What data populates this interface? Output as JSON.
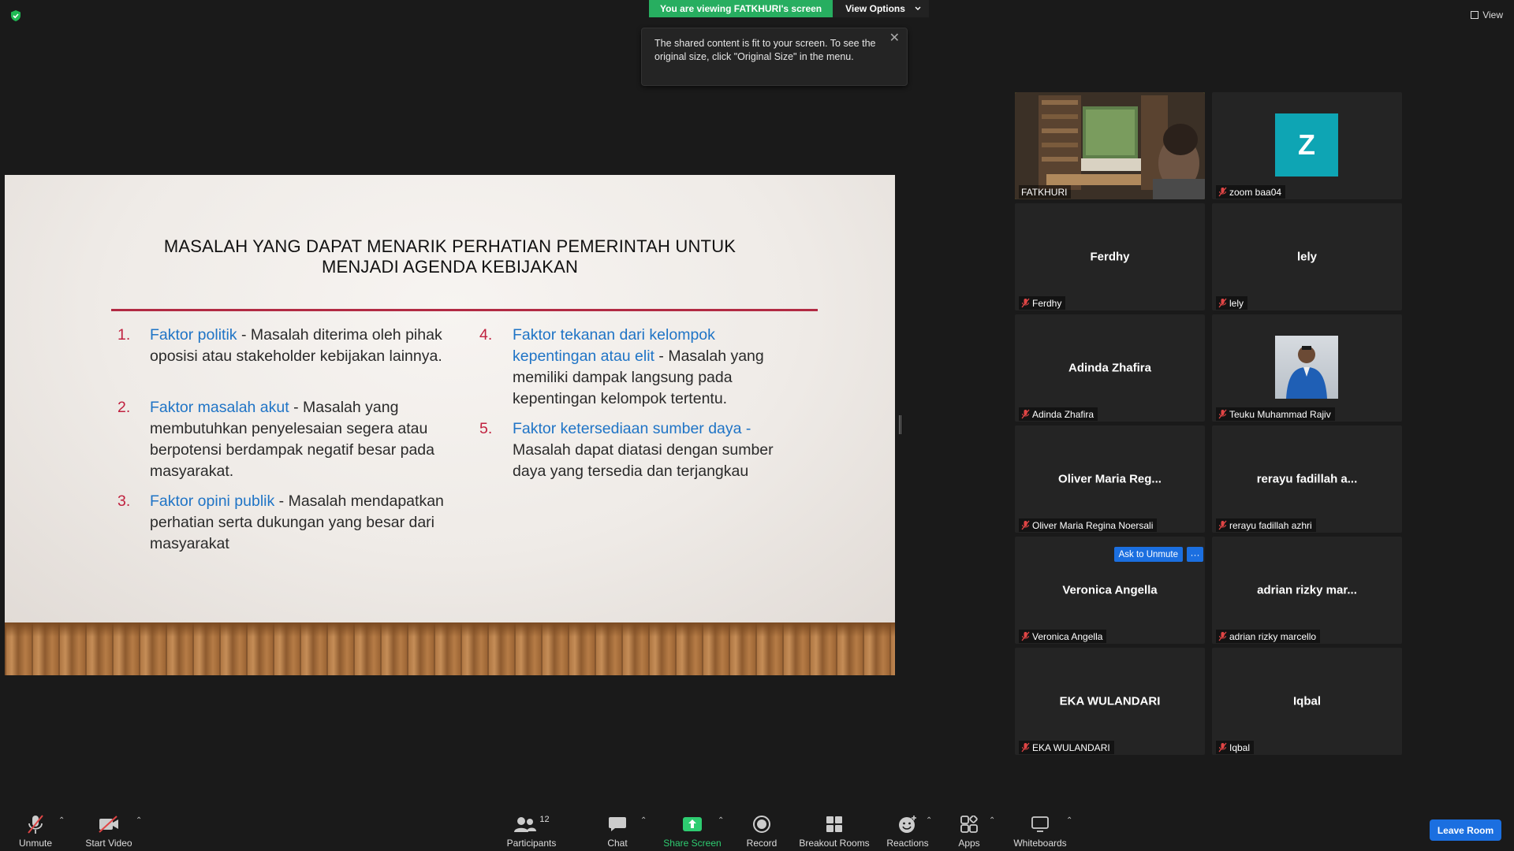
{
  "banner": {
    "viewing": "You are viewing FATKHURI's screen",
    "view_options": "View Options"
  },
  "top_right": {
    "view": "View"
  },
  "tooltip": {
    "text": "The shared content is fit to your screen. To see the original size, click \"Original Size\" in the menu."
  },
  "slide": {
    "title": "MASALAH YANG DAPAT MENARIK PERHATIAN PEMERINTAH UNTUK MENJADI AGENDA KEBIJAKAN",
    "items": [
      {
        "num": "1.",
        "head": "Faktor politik",
        "body": "Masalah diterima oleh pihak oposisi atau stakeholder kebijakan lainnya."
      },
      {
        "num": "2.",
        "head": "Faktor masalah akut",
        "body": "Masalah yang membutuhkan penyelesaian segera atau berpotensi berdampak negatif besar pada masyarakat."
      },
      {
        "num": "3.",
        "head": "Faktor opini publik",
        "body": "Masalah mendapatkan perhatian serta dukungan yang besar dari masyarakat"
      },
      {
        "num": "4.",
        "head": "Faktor tekanan dari kelompok kepentingan atau elit",
        "body": "Masalah yang memiliki dampak langsung pada kepentingan kelompok tertentu."
      },
      {
        "num": "5.",
        "head": "Faktor ketersediaan sumber daya -",
        "body": "Masalah dapat diatasi dengan sumber daya yang tersedia dan terjangkau"
      }
    ]
  },
  "participants": [
    {
      "display": "",
      "tag": "FATKHURI"
    },
    {
      "display": "Z",
      "tag": "zoom baa04"
    },
    {
      "display": "Ferdhy",
      "tag": "Ferdhy"
    },
    {
      "display": "lely",
      "tag": "lely"
    },
    {
      "display": "Adinda Zhafira",
      "tag": "Adinda Zhafira"
    },
    {
      "display": "",
      "tag": "Teuku Muhammad Rajiv"
    },
    {
      "display": "Oliver Maria Reg...",
      "tag": "Oliver Maria Regina Noersali"
    },
    {
      "display": "rerayu fadillah a...",
      "tag": "rerayu fadillah azhri"
    },
    {
      "display": "Veronica Angella",
      "tag": "Veronica Angella"
    },
    {
      "display": "adrian rizky mar...",
      "tag": "adrian rizky marcello"
    },
    {
      "display": "EKA WULANDARI",
      "tag": "EKA WULANDARI"
    },
    {
      "display": "Iqbal",
      "tag": "Iqbal"
    }
  ],
  "hover_actions": {
    "ask_unmute": "Ask to Unmute",
    "more": "···"
  },
  "toolbar": {
    "unmute": "Unmute",
    "start_video": "Start Video",
    "participants": "Participants",
    "participants_count": "12",
    "chat": "Chat",
    "share_screen": "Share Screen",
    "record": "Record",
    "breakout_rooms": "Breakout Rooms",
    "reactions": "Reactions",
    "apps": "Apps",
    "whiteboards": "Whiteboards",
    "leave_room": "Leave Room"
  },
  "colors": {
    "accent_green": "#27ae60",
    "accent_blue": "#1b6fe0",
    "active_speaker": "#e5f03b",
    "slide_red": "#c0213f",
    "slide_blue": "#1f74c6"
  },
  "icons": [
    "shield-check-icon",
    "grid-view-icon",
    "close-icon",
    "mic-muted-icon",
    "video-off-icon",
    "participants-icon",
    "chat-icon",
    "share-screen-icon",
    "record-icon",
    "breakout-rooms-icon",
    "reactions-icon",
    "apps-icon",
    "whiteboard-icon",
    "chevron-up-icon",
    "chevron-down-icon"
  ]
}
